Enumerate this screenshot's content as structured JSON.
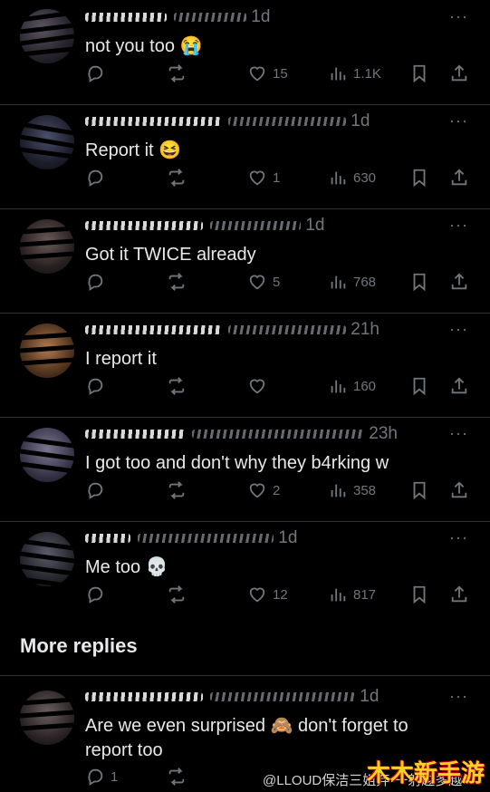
{
  "replies": [
    {
      "time": "1d",
      "text": "not you too 😭",
      "likes": "15",
      "views": "1.1K",
      "reply_count": ""
    },
    {
      "handle_fragment": "@",
      "time": "1d",
      "text": "Report it 😆",
      "likes": "1",
      "views": "630",
      "reply_count": ""
    },
    {
      "time": "1d",
      "text": "Got it TWICE already",
      "likes": "5",
      "views": "768",
      "reply_count": ""
    },
    {
      "time": "21h",
      "text": "I report it",
      "likes": "",
      "views": "160",
      "reply_count": ""
    },
    {
      "time": "23h",
      "text": "I got too and don't why they b4rking w",
      "likes": "2",
      "views": "358",
      "reply_count": ""
    },
    {
      "time": "1d",
      "text": "Me too 💀",
      "likes": "12",
      "views": "817",
      "reply_count": ""
    },
    {
      "time": "1d",
      "text": "Are we even surprised 🙈 don't forget to report too",
      "likes": "",
      "views": "",
      "reply_count": "1"
    }
  ],
  "section": {
    "more_replies": "More replies"
  },
  "watermark": "@LLOUD保洁三姐弃·一射越多越",
  "corner_logo": "木木新手游",
  "more_icon": "···",
  "colors": {
    "bg": "#000000",
    "text": "#e7e9ea",
    "muted": "#71767b",
    "border": "#2f3336"
  }
}
